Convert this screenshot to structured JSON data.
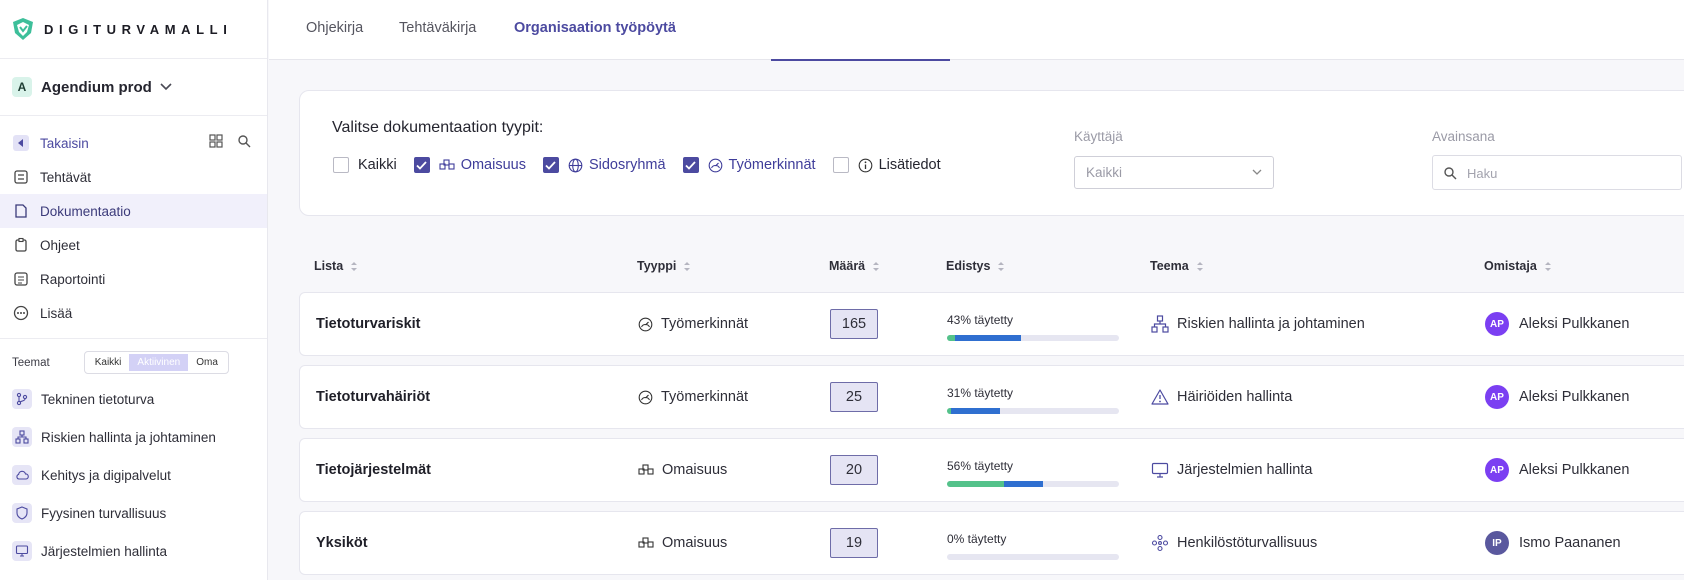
{
  "brand": {
    "name": "DIGITURVAMALLI"
  },
  "org": {
    "initial": "A",
    "name": "Agendium prod"
  },
  "nav": {
    "back": "Takaisin",
    "items": [
      "Tehtävät",
      "Dokumentaatio",
      "Ohjeet",
      "Raportointi",
      "Lisää"
    ]
  },
  "themes": {
    "title": "Teemat",
    "filters": [
      "Kaikki",
      "Aktiivinen",
      "Oma"
    ],
    "items": [
      "Tekninen tietoturva",
      "Riskien hallinta ja johtaminen",
      "Kehitys ja digipalvelut",
      "Fyysinen turvallisuus",
      "Järjestelmien hallinta"
    ]
  },
  "tabs": [
    "Ohjekirja",
    "Tehtäväkirja",
    "Organisaation työpöytä"
  ],
  "filter": {
    "title": "Valitse dokumentaation tyypit:",
    "types": [
      {
        "label": "Kaikki",
        "checked": false
      },
      {
        "label": "Omaisuus",
        "checked": true
      },
      {
        "label": "Sidosryhmä",
        "checked": true
      },
      {
        "label": "Työmerkinnät",
        "checked": true
      },
      {
        "label": "Lisätiedot",
        "checked": false
      }
    ],
    "user_label": "Käyttäjä",
    "user_value": "Kaikki",
    "keyword_label": "Avainsana",
    "keyword_placeholder": "Haku"
  },
  "table": {
    "columns": [
      "Lista",
      "Tyyppi",
      "Määrä",
      "Edistys",
      "Teema",
      "Omistaja"
    ],
    "rows": [
      {
        "name": "Tietoturvariskit",
        "type": "Työmerkinnät",
        "count": "165",
        "progress_text": "43% täytetty",
        "progress": 43,
        "theme": "Riskien hallinta ja johtaminen",
        "owner_initials": "AP",
        "owner": "Aleksi Pulkkanen"
      },
      {
        "name": "Tietoturvahäiriöt",
        "type": "Työmerkinnät",
        "count": "25",
        "progress_text": "31% täytetty",
        "progress": 31,
        "theme": "Häiriöiden hallinta",
        "owner_initials": "AP",
        "owner": "Aleksi Pulkkanen"
      },
      {
        "name": "Tietojärjestelmät",
        "type": "Omaisuus",
        "count": "20",
        "progress_text": "56% täytetty",
        "progress": 56,
        "theme": "Järjestelmien hallinta",
        "owner_initials": "AP",
        "owner": "Aleksi Pulkkanen"
      },
      {
        "name": "Yksiköt",
        "type": "Omaisuus",
        "count": "19",
        "progress_text": "0% täytetty",
        "progress": 0,
        "theme": "Henkilöstöturvallisuus",
        "owner_initials": "IP",
        "owner": "Ismo Paananen"
      }
    ]
  },
  "colors": {
    "accent": "#4c4aa0",
    "avatar_ap": "#7b3ff2",
    "avatar_ip": "#5a589e",
    "progress_green": "#54c28a",
    "progress_blue": "#2f6fd0"
  }
}
